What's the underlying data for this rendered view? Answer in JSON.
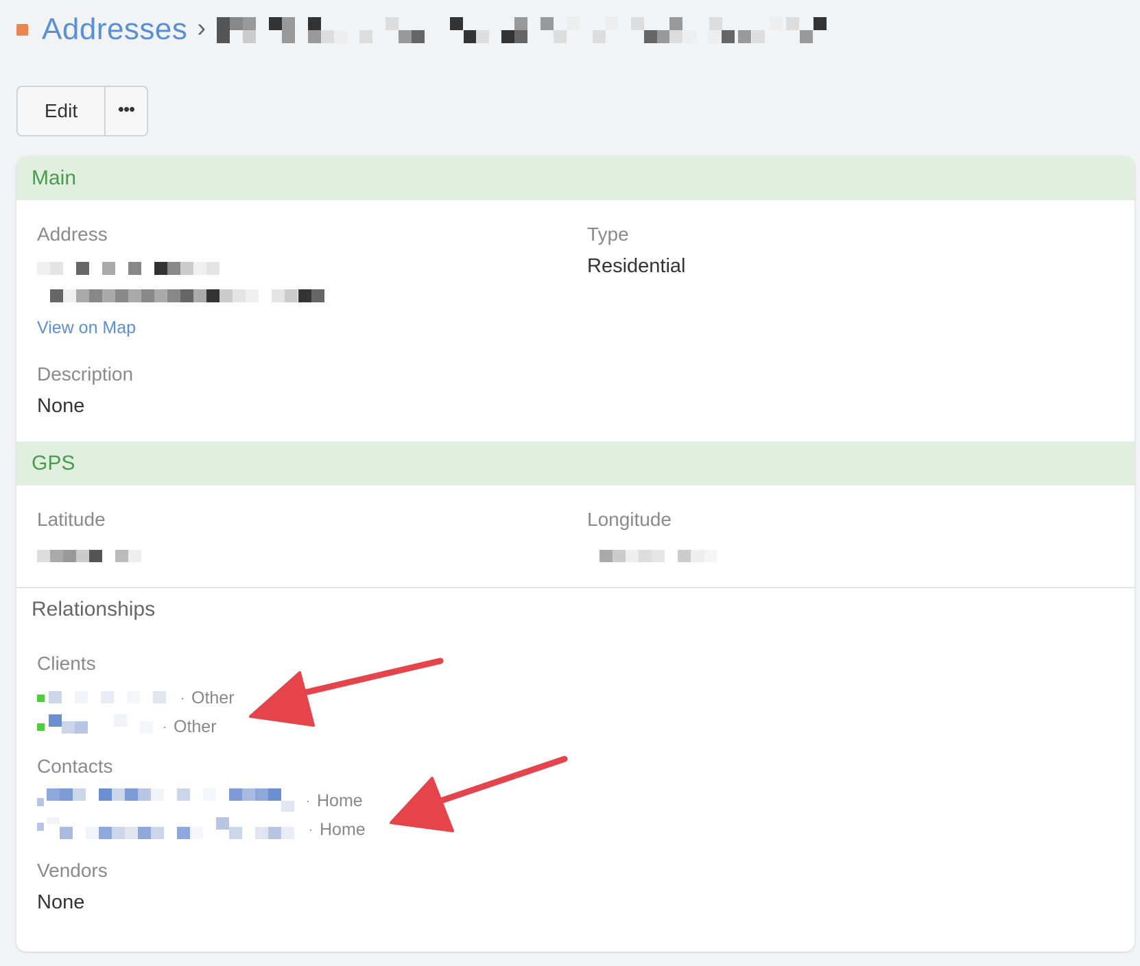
{
  "breadcrumb": {
    "section_label": "Addresses",
    "separator": "›"
  },
  "toolbar": {
    "edit_label": "Edit",
    "more_label": "•••"
  },
  "main_section": {
    "title": "Main",
    "address_label": "Address",
    "view_on_map_label": "View on Map",
    "type_label": "Type",
    "type_value": "Residential",
    "description_label": "Description",
    "description_value": "None"
  },
  "gps_section": {
    "title": "GPS",
    "latitude_label": "Latitude",
    "longitude_label": "Longitude"
  },
  "relationships": {
    "title": "Relationships",
    "clients_label": "Clients",
    "clients": [
      {
        "role": "Other"
      },
      {
        "role": "Other"
      }
    ],
    "contacts_label": "Contacts",
    "contacts": [
      {
        "role": "Home"
      },
      {
        "role": "Home"
      }
    ],
    "vendors_label": "Vendors",
    "vendors_value": "None"
  },
  "colors": {
    "link": "#5b8fd3",
    "section_header_bg": "#e0efe0",
    "section_header_text": "#4a9a4a",
    "brand_square": "#e8864f",
    "client_status": "#4ccf3a",
    "annotation_arrow": "#e5454a"
  }
}
